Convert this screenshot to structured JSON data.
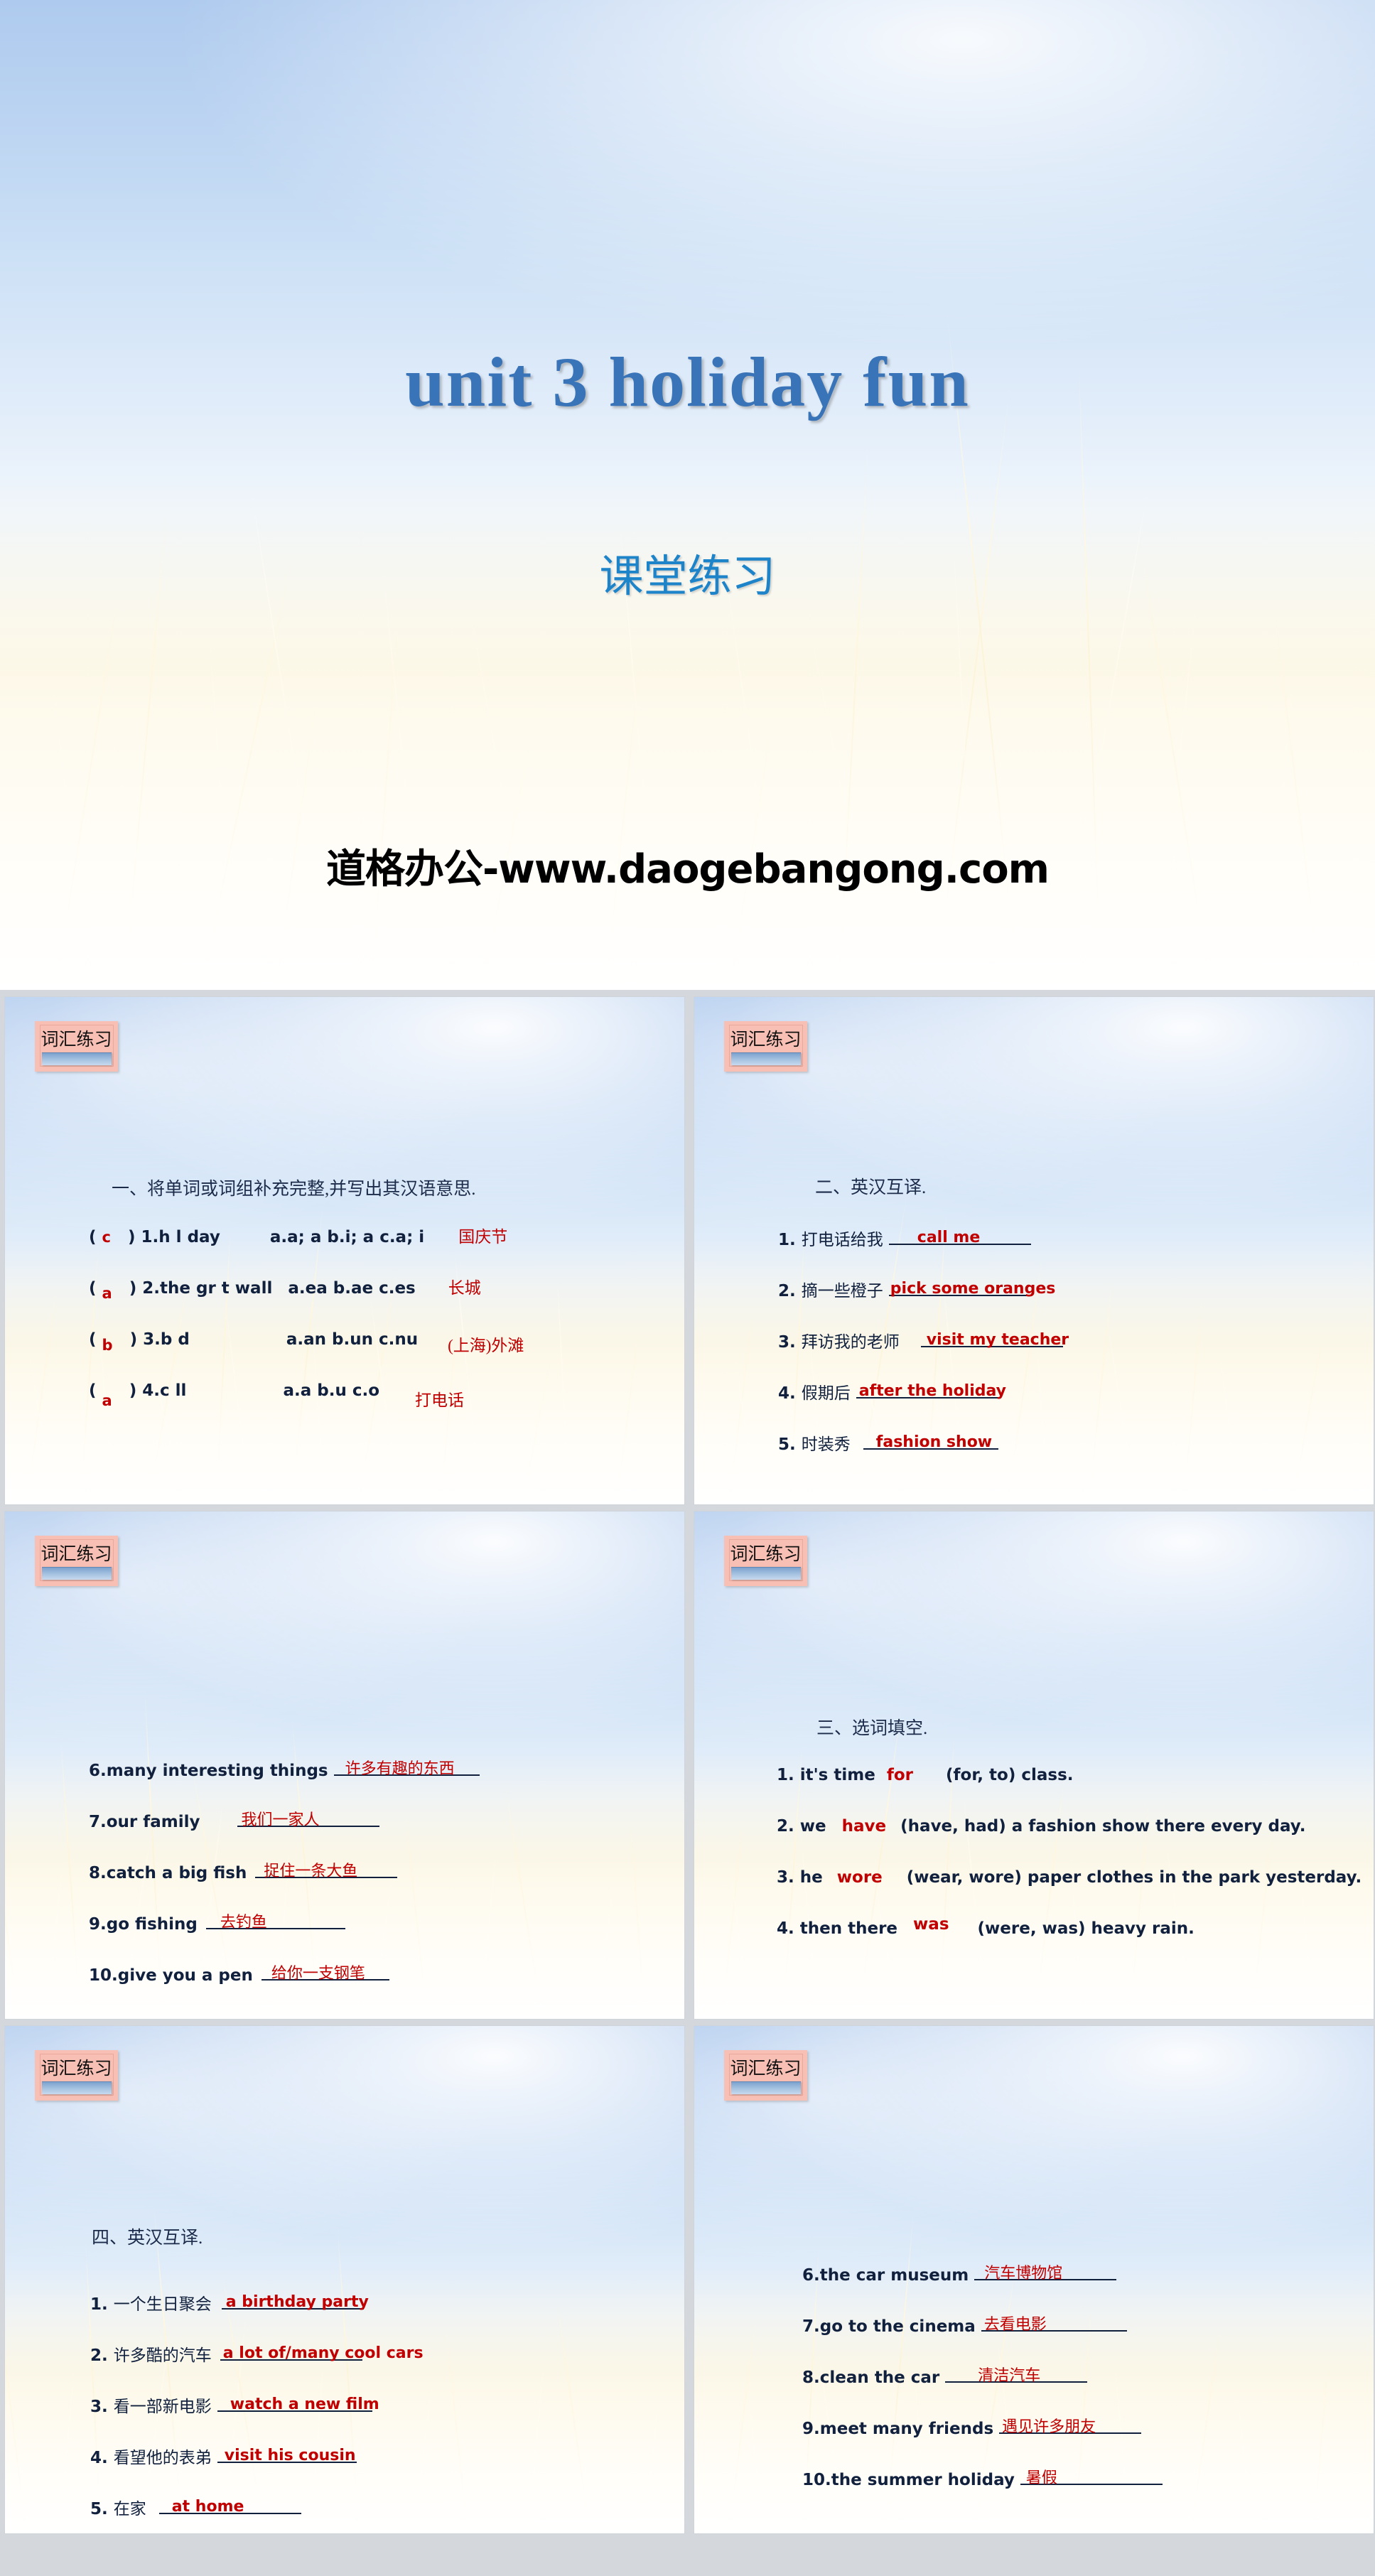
{
  "title_slide": {
    "main_title": "unit 3  holiday fun",
    "subtitle": "课堂练习",
    "watermark": "道格办公-www.daogebangong.com",
    "colors": {
      "title": "#3a74b8",
      "subtitle": "#1e84c9",
      "watermark": "#000000"
    }
  },
  "badge_label": "词汇练习",
  "colors": {
    "answer_red": "#c00000",
    "body_navy": "#10203d",
    "badge_pink": "#f8bfb4"
  },
  "slides": [
    {
      "id": "slide-ex1",
      "badge": "词汇练习",
      "heading": "一、将单词或词组补充完整,并写出其汉语意思.",
      "items": [
        {
          "choice": "c",
          "num": "1.",
          "stem": "h  l day",
          "options": "a.a; a    b.i; a      c.a; i",
          "meaning": "国庆节"
        },
        {
          "choice": "a",
          "num": "2.",
          "stem": "the gr   t wall",
          "options": "a.ea     b.ae       c.es",
          "meaning": "长城"
        },
        {
          "choice": "b",
          "num": "3.",
          "stem": "b  d",
          "options": "a.an     b.un     c.nu",
          "meaning": "(上海)外滩"
        },
        {
          "choice": "a",
          "num": "4.",
          "stem": "c  ll",
          "options": "a.a       b.u       c.o",
          "meaning": "打电话"
        }
      ]
    },
    {
      "id": "slide-ex2",
      "badge": "词汇练习",
      "heading": "二、英汉互译.",
      "items": [
        {
          "num": "1.",
          "prompt": "打电话给我",
          "answer": "call me"
        },
        {
          "num": "2.",
          "prompt": "摘一些橙子",
          "answer": "pick some oranges"
        },
        {
          "num": "3.",
          "prompt": "拜访我的老师",
          "answer": "visit my teacher"
        },
        {
          "num": "4.",
          "prompt": "假期后",
          "answer": "after the holiday"
        },
        {
          "num": "5.",
          "prompt": "时装秀",
          "answer": "fashion show"
        }
      ]
    },
    {
      "id": "slide-ex3",
      "badge": "词汇练习",
      "heading": "",
      "items": [
        {
          "num": "6.",
          "prompt": "many interesting things",
          "answer": "许多有趣的东西"
        },
        {
          "num": "7.",
          "prompt": "our family",
          "answer": "我们一家人"
        },
        {
          "num": "8.",
          "prompt": "catch a big fish",
          "answer": "捉住一条大鱼"
        },
        {
          "num": "9.",
          "prompt": "go fishing",
          "answer": "去钓鱼"
        },
        {
          "num": "10.",
          "prompt": "give you a pen",
          "answer": "给你一支钢笔"
        }
      ]
    },
    {
      "id": "slide-ex4",
      "badge": "词汇练习",
      "heading": "三、选词填空.",
      "items": [
        {
          "num": "1.",
          "before": "it's time",
          "answer": "for",
          "after": "(for, to) class."
        },
        {
          "num": "2.",
          "before": "we",
          "answer": "have",
          "after": "(have, had) a fashion show there every day."
        },
        {
          "num": "3.",
          "before": "he",
          "answer": "wore",
          "after": "(wear, wore) paper clothes in the park yesterday."
        },
        {
          "num": "4.",
          "before": "then there",
          "answer": "was",
          "after": "(were, was) heavy rain."
        }
      ]
    },
    {
      "id": "slide-ex5",
      "badge": "词汇练习",
      "heading": "四、英汉互译.",
      "items": [
        {
          "num": "1.",
          "prompt": "一个生日聚会",
          "answer": "a birthday party"
        },
        {
          "num": "2.",
          "prompt": "许多酷的汽车",
          "answer": "a lot of/many cool cars"
        },
        {
          "num": "3.",
          "prompt": "看一部新电影",
          "answer": "watch a new film"
        },
        {
          "num": "4.",
          "prompt": "看望他的表弟",
          "answer": "visit his cousin"
        },
        {
          "num": "5.",
          "prompt": "在家",
          "answer": "at home"
        }
      ]
    },
    {
      "id": "slide-ex6",
      "badge": "词汇练习",
      "heading": "",
      "items": [
        {
          "num": "6.",
          "prompt": "the car museum",
          "answer": "汽车博物馆"
        },
        {
          "num": "7.",
          "prompt": "go to the cinema",
          "answer": "去看电影"
        },
        {
          "num": "8.",
          "prompt": "clean the car",
          "answer": "清洁汽车"
        },
        {
          "num": "9.",
          "prompt": "meet many friends",
          "answer": "遇见许多朋友"
        },
        {
          "num": "10.",
          "prompt": "the summer holiday",
          "answer": "暑假"
        }
      ]
    }
  ]
}
